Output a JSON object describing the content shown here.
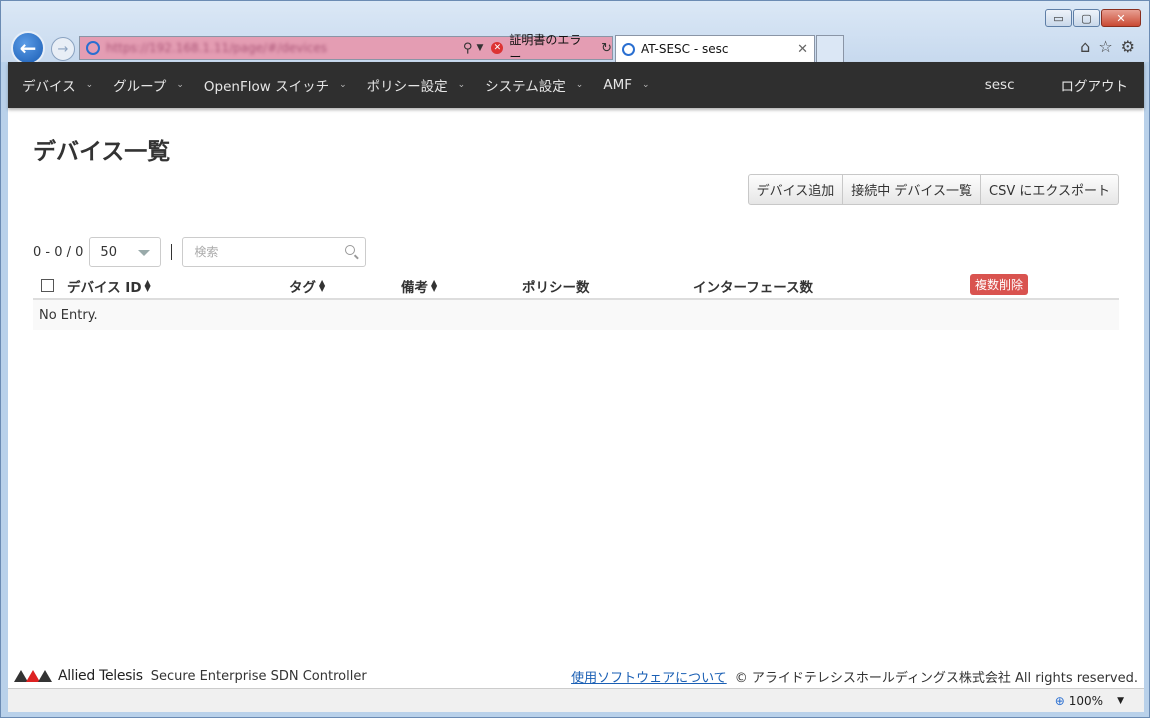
{
  "window": {
    "minimize": "▭",
    "maximize": "▢",
    "close": "✕"
  },
  "browser": {
    "address_url": "https://192.168.1.11/page/#/devices",
    "cert_error": "証明書のエラー",
    "tab_title": "AT-SESC - sesc",
    "icons": [
      "back-arrow-icon",
      "forward-arrow-icon",
      "ie-icon",
      "search-icon",
      "refresh-icon",
      "home-icon",
      "star-icon",
      "gear-icon"
    ]
  },
  "nav": {
    "items": [
      {
        "label": "デバイス"
      },
      {
        "label": "グループ"
      },
      {
        "label": "OpenFlow スイッチ"
      },
      {
        "label": "ポリシー設定"
      },
      {
        "label": "システム設定"
      },
      {
        "label": "AMF"
      }
    ],
    "user": "sesc",
    "logout": "ログアウト"
  },
  "main": {
    "title": "デバイス一覧",
    "buttons": {
      "add": "デバイス追加",
      "connected": "接続中 デバイス一覧",
      "export": "CSV にエクスポート"
    },
    "pagination": {
      "range": "0 - 0 / 0",
      "page_size": "50"
    },
    "search": {
      "placeholder": "検索"
    },
    "table": {
      "columns": {
        "device_id": "デバイス ID",
        "tag": "タグ",
        "note": "備考",
        "policy_count": "ポリシー数",
        "interface_count": "インターフェース数"
      },
      "bulk_delete": "複数削除",
      "empty": "No Entry."
    }
  },
  "footer": {
    "brand": "Allied Telesis",
    "product": "Secure Enterprise SDN Controller",
    "link": "使用ソフトウェアについて",
    "copyright": "© アライドテレシスホールディングス株式会社 All rights reserved."
  },
  "status": {
    "zoom": "100%"
  },
  "colors": {
    "navbar": "#2f2f2f",
    "danger": "#d9534f",
    "link": "#1a5fb4",
    "address_error": "#e49db3"
  }
}
